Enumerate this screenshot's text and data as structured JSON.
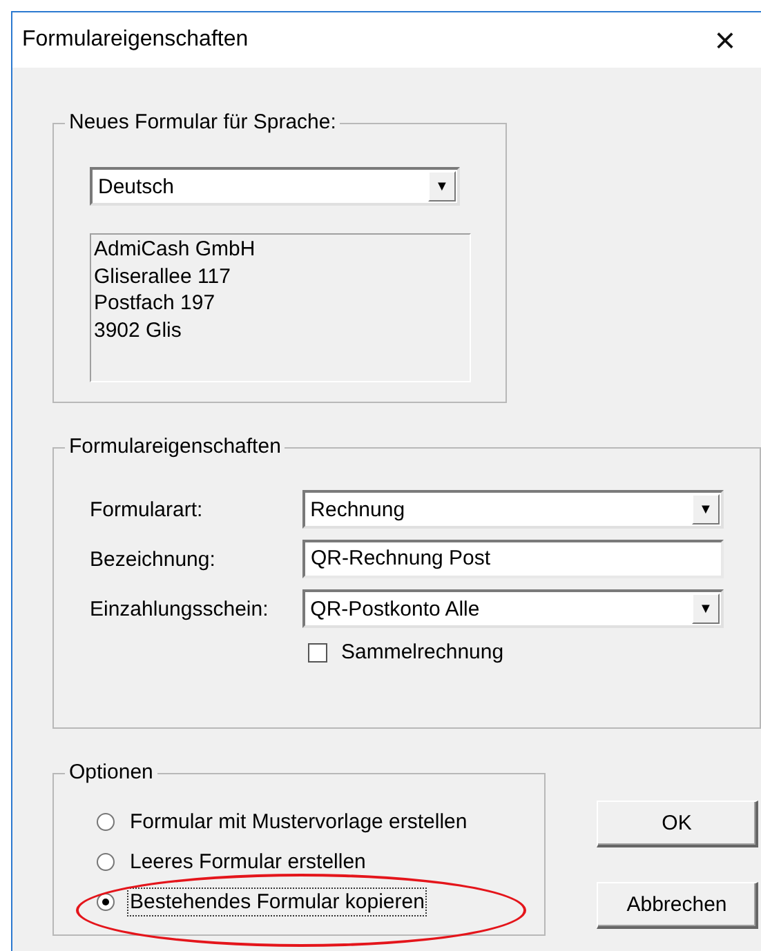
{
  "window": {
    "title": "Formulareigenschaften",
    "close": "×"
  },
  "language_group": {
    "title": "Neues Formular für Sprache:",
    "language": {
      "value": "Deutsch",
      "arrow": "▼"
    },
    "address_lines": [
      "AdmiCash GmbH",
      "Gliserallee 117",
      "Postfach 197",
      "3902 Glis"
    ]
  },
  "properties_group": {
    "title": "Formulareigenschaften",
    "fields": [
      {
        "kind": "dropdown",
        "label": "Formularart:",
        "value": "Rechnung",
        "arrow": "▼"
      },
      {
        "kind": "text",
        "label": "Bezeichnung:",
        "value": "QR-Rechnung Post"
      },
      {
        "kind": "dropdown",
        "label": "Einzahlungsschein:",
        "value": "QR-Postkonto Alle",
        "arrow": "▼"
      }
    ],
    "checkbox": {
      "label": "Sammelrechnung",
      "checked": false
    }
  },
  "options_group": {
    "title": "Optionen",
    "options": [
      {
        "label": "Formular mit Mustervorlage erstellen",
        "selected": false,
        "circled": false
      },
      {
        "label": "Leeres Formular erstellen",
        "selected": false,
        "circled": false
      },
      {
        "label": "Bestehendes Formular kopieren",
        "selected": true,
        "circled": true
      }
    ]
  },
  "buttons": [
    "OK",
    "Abbrechen"
  ]
}
